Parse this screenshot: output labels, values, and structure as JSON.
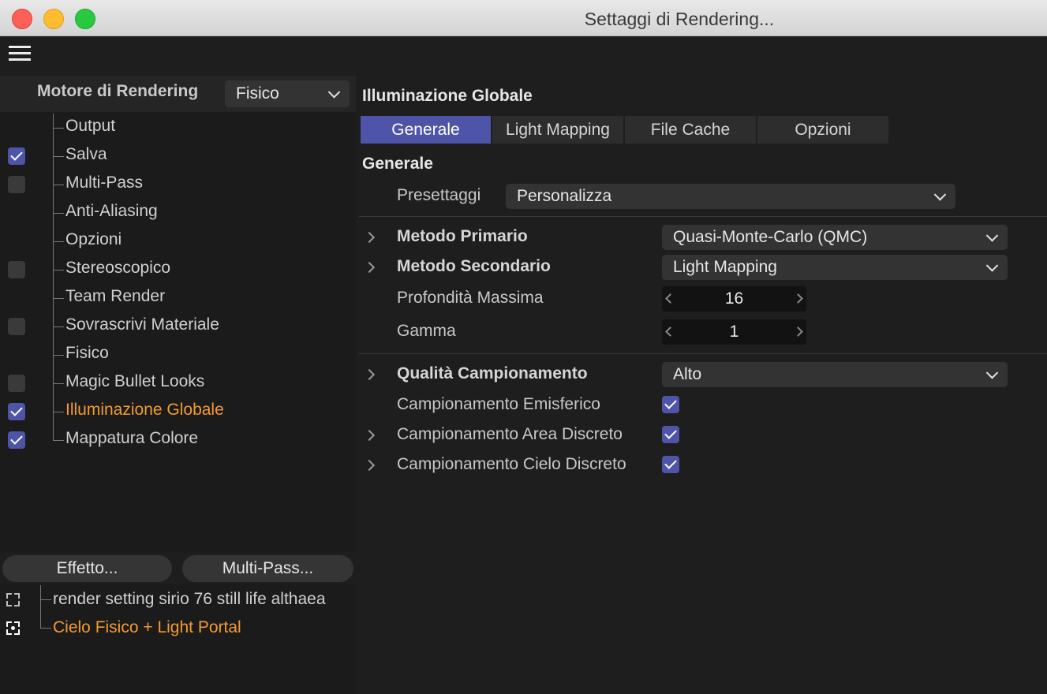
{
  "window": {
    "title": "Settaggi di Rendering..."
  },
  "engine": {
    "label": "Motore di Rendering",
    "value": "Fisico"
  },
  "tree": {
    "items": [
      {
        "label": "Output",
        "checkbox": "none"
      },
      {
        "label": "Salva",
        "checkbox": "checked"
      },
      {
        "label": "Multi-Pass",
        "checkbox": "unchecked"
      },
      {
        "label": "Anti-Aliasing",
        "checkbox": "none"
      },
      {
        "label": "Opzioni",
        "checkbox": "none"
      },
      {
        "label": "Stereoscopico",
        "checkbox": "unchecked"
      },
      {
        "label": "Team Render",
        "checkbox": "none"
      },
      {
        "label": "Sovrascrivi Materiale",
        "checkbox": "unchecked"
      },
      {
        "label": "Fisico",
        "checkbox": "none"
      },
      {
        "label": "Magic Bullet Looks",
        "checkbox": "unchecked"
      },
      {
        "label": "Illuminazione Globale",
        "checkbox": "checked",
        "active": true
      },
      {
        "label": "Mappatura Colore",
        "checkbox": "checked"
      }
    ]
  },
  "buttons": {
    "effect": "Effetto...",
    "multipass": "Multi-Pass..."
  },
  "effects": {
    "items": [
      {
        "label": "render setting sirio 76 still life althaea"
      },
      {
        "label": "Cielo Fisico + Light Portal",
        "active": true
      }
    ]
  },
  "panel": {
    "title": "Illuminazione Globale",
    "tabs": [
      "Generale",
      "Light Mapping",
      "File Cache",
      "Opzioni"
    ],
    "active_tab": "Generale",
    "section": "Generale",
    "preset": {
      "label": "Presettaggi",
      "value": "Personalizza"
    },
    "primary": {
      "label": "Metodo Primario",
      "value": "Quasi-Monte-Carlo (QMC)"
    },
    "secondary": {
      "label": "Metodo Secondario",
      "value": "Light Mapping"
    },
    "depth": {
      "label": "Profondità Massima",
      "value": "16"
    },
    "gamma": {
      "label": "Gamma",
      "value": "1"
    },
    "quality": {
      "label": "Qualità Campionamento",
      "value": "Alto"
    },
    "hemi": {
      "label": "Campionamento Emisferico",
      "checked": true
    },
    "area": {
      "label": "Campionamento Area Discreto",
      "checked": true
    },
    "sky": {
      "label": "Campionamento Cielo Discreto",
      "checked": true
    }
  },
  "colors": {
    "accent": "#4e55a8",
    "active_text": "#f39b30",
    "background": "#1e1e1e"
  }
}
